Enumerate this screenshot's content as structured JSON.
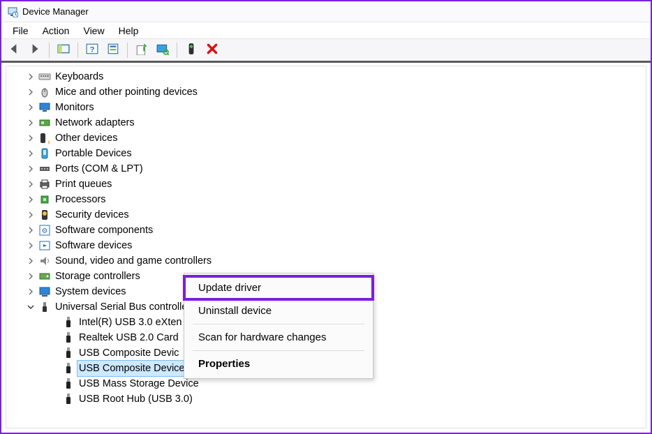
{
  "titlebar": {
    "title": "Device Manager"
  },
  "menubar": {
    "items": [
      "File",
      "Action",
      "View",
      "Help"
    ]
  },
  "toolbar": {
    "buttons": [
      {
        "name": "back-button",
        "icon": "arrow-left",
        "disabled": true
      },
      {
        "name": "forward-button",
        "icon": "arrow-right",
        "disabled": true
      },
      {
        "name": "_sep"
      },
      {
        "name": "show-hide-button",
        "icon": "panel"
      },
      {
        "name": "_sep"
      },
      {
        "name": "help-button",
        "icon": "help"
      },
      {
        "name": "properties-button",
        "icon": "props"
      },
      {
        "name": "_sep"
      },
      {
        "name": "update-driver-toolbar-button",
        "icon": "update"
      },
      {
        "name": "scan-button",
        "icon": "monitor-scan"
      },
      {
        "name": "_sep"
      },
      {
        "name": "enable-button",
        "icon": "enable"
      },
      {
        "name": "uninstall-toolbar-button",
        "icon": "x"
      }
    ]
  },
  "tree": {
    "categories": [
      {
        "icon": "keyboard",
        "label": "Keyboards"
      },
      {
        "icon": "mouse",
        "label": "Mice and other pointing devices"
      },
      {
        "icon": "monitor",
        "label": "Monitors"
      },
      {
        "icon": "nic",
        "label": "Network adapters"
      },
      {
        "icon": "other",
        "label": "Other devices"
      },
      {
        "icon": "portable",
        "label": "Portable Devices"
      },
      {
        "icon": "port",
        "label": "Ports (COM & LPT)"
      },
      {
        "icon": "printer",
        "label": "Print queues"
      },
      {
        "icon": "cpu",
        "label": "Processors"
      },
      {
        "icon": "security",
        "label": "Security devices"
      },
      {
        "icon": "swcomp",
        "label": "Software components"
      },
      {
        "icon": "swdev",
        "label": "Software devices"
      },
      {
        "icon": "sound",
        "label": "Sound, video and game controllers"
      },
      {
        "icon": "storage",
        "label": "Storage controllers"
      },
      {
        "icon": "sysdev",
        "label": "System devices"
      }
    ],
    "usb": {
      "label": "Universal Serial Bus controllers",
      "children": [
        "Intel(R) USB 3.0 eXten",
        "Realtek USB 2.0 Card",
        "USB Composite Devic",
        "USB Composite Device",
        "USB Mass Storage Device",
        "USB Root Hub (USB 3.0)"
      ],
      "selected_index": 3
    }
  },
  "ctx": {
    "items": [
      {
        "key": "update",
        "label": "Update driver",
        "highlight": true
      },
      {
        "key": "uninstall",
        "label": "Uninstall device"
      },
      {
        "key": "_sep"
      },
      {
        "key": "scan",
        "label": "Scan for hardware changes"
      },
      {
        "key": "_sep"
      },
      {
        "key": "props",
        "label": "Properties",
        "bold": true
      }
    ]
  }
}
